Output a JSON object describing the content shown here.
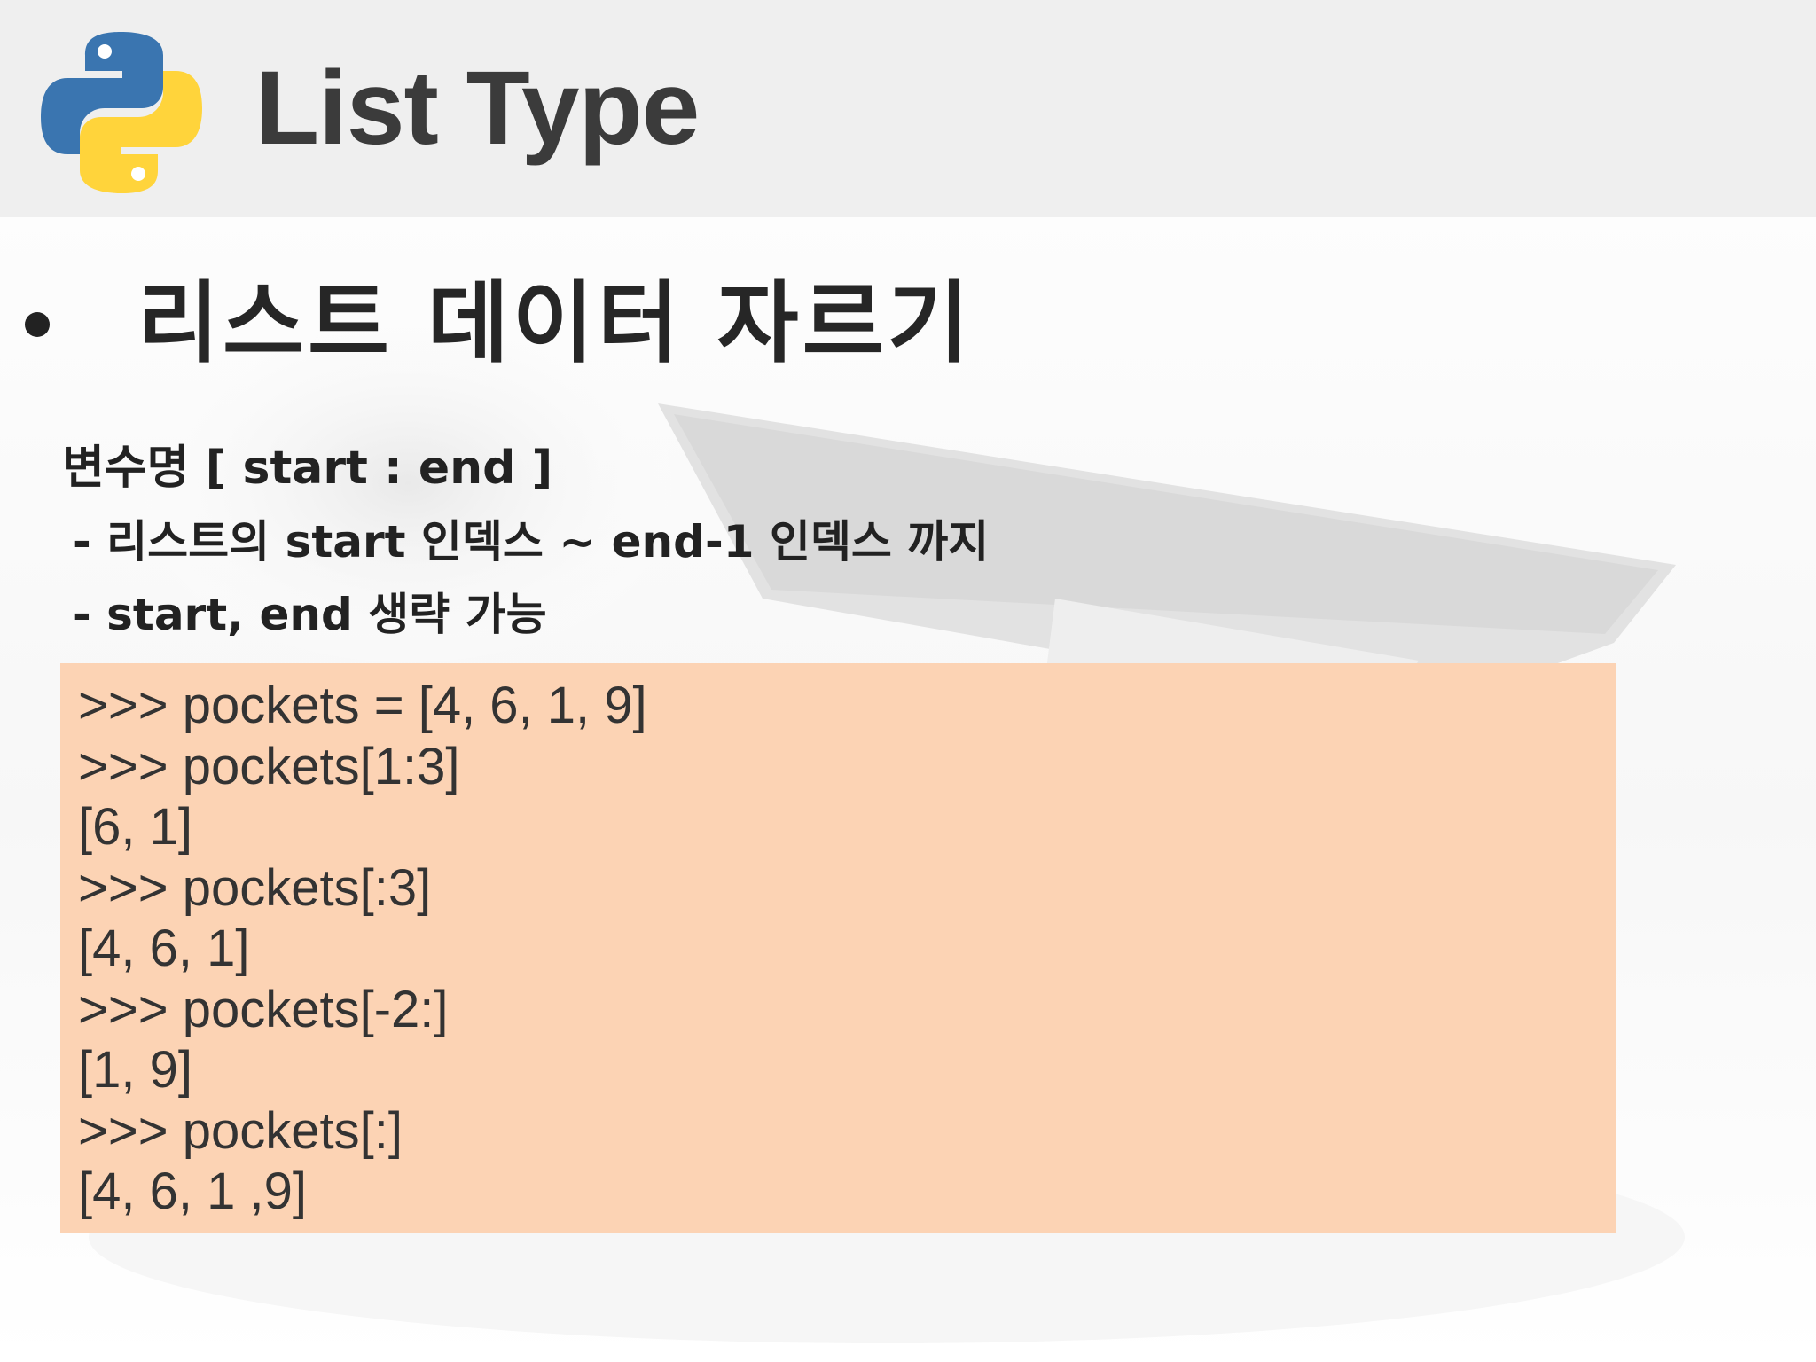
{
  "header": {
    "title": "List Type",
    "logo_icon": "python-logo-icon",
    "colors": {
      "logo_blue": "#3a75b0",
      "logo_yellow": "#ffd43b",
      "band": "#efefef"
    }
  },
  "content": {
    "bullet_icon": "bullet-dot-icon",
    "heading": "리스트 데이터 자르기",
    "syntax": "변수명 [ start : end ]",
    "descriptions": [
      "- 리스트의 start 인덱스 ~ end-1 인덱스 까지",
      "- start, end 생략 가능"
    ]
  },
  "code_block": {
    "background": "#fcd3b4",
    "lines": [
      ">>> pockets = [4, 6, 1, 9]",
      ">>> pockets[1:3]",
      "[6, 1]",
      ">>> pockets[:3]",
      "[4, 6, 1]",
      ">>> pockets[-2:]",
      "[1, 9]",
      ">>> pockets[:]",
      "[4, 6, 1 ,9]"
    ]
  }
}
